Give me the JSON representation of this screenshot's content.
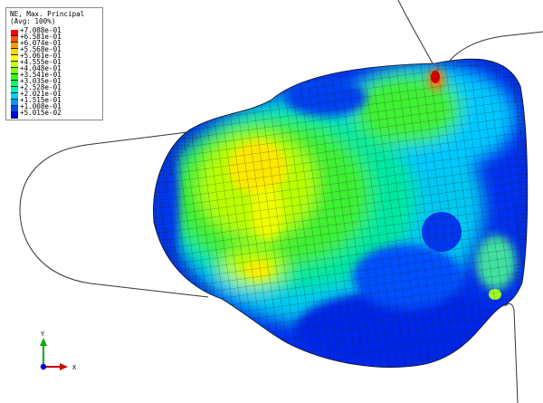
{
  "legend": {
    "title": "NE, Max. Principal",
    "subtitle": "(Avg: 100%)",
    "values": [
      "+7.088e-01",
      "+6.581e-01",
      "+6.074e-01",
      "+5.568e-01",
      "+5.061e-01",
      "+4.555e-01",
      "+4.048e-01",
      "+3.541e-01",
      "+3.035e-01",
      "+2.528e-01",
      "+2.021e-01",
      "+1.515e-01",
      "+1.008e-01",
      "+5.015e-02"
    ],
    "colors": [
      "#ff0000",
      "#ff5500",
      "#ff9a00",
      "#ffd400",
      "#ffff00",
      "#c4ff00",
      "#7cff00",
      "#2dff18",
      "#00ff66",
      "#00f0b4",
      "#00d2f0",
      "#0096ff",
      "#0048ff",
      "#0000e6"
    ]
  },
  "triad": {
    "y_label": "Y",
    "x_label": "X",
    "colors": {
      "x": "#cc0000",
      "y": "#00aa00",
      "z": "#0000cc"
    }
  }
}
